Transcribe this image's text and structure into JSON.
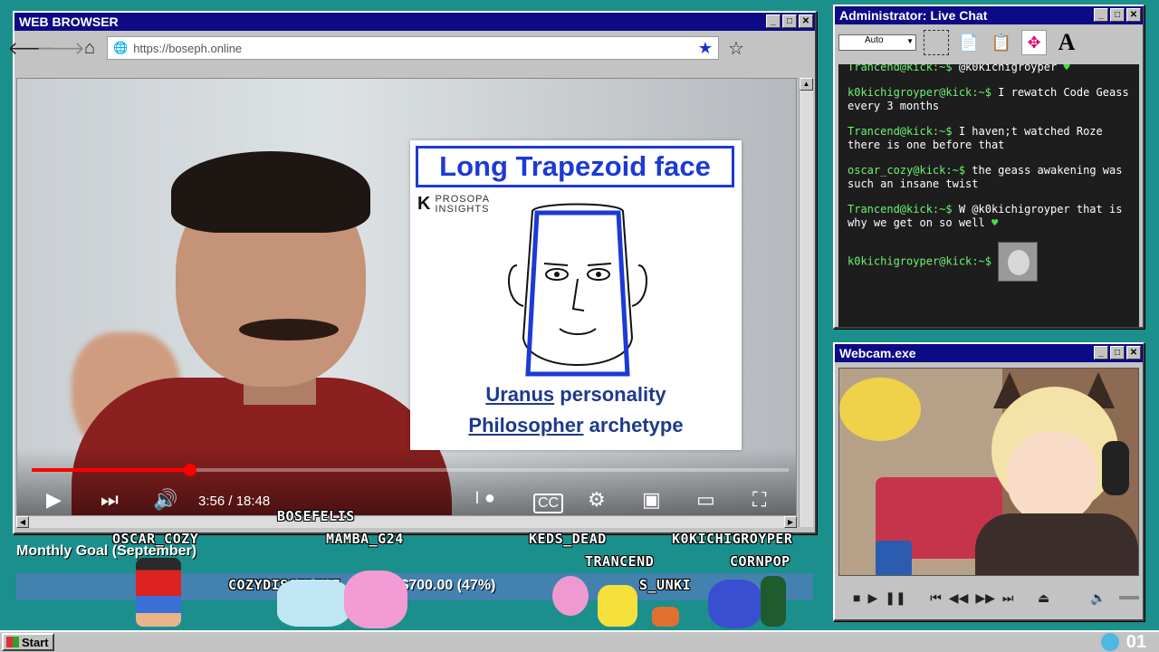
{
  "browser": {
    "title": "WEB BROWSER",
    "url": "https://boseph.online"
  },
  "slide": {
    "title": "Long Trapezoid face",
    "brand_line1": "PROSOPA",
    "brand_line2": "INSIGHTS",
    "line1_link": "Uranus",
    "line1_rest": " personality",
    "line2_link": "Philosopher",
    "line2_rest": " archetype"
  },
  "player": {
    "time": "3:56 / 18:48",
    "progress_fraction": 0.209
  },
  "chat": {
    "title": "Administrator: Live Chat",
    "font_select": "Auto",
    "messages": [
      {
        "user": "Trancend@kick:~$",
        "text": " @k0kichigroyper"
      },
      {
        "user": "k0kichigroyper@kick:~$",
        "text": " I rewatch Code Geass every 3 months"
      },
      {
        "user": "Trancend@kick:~$",
        "text": " I haven;t watched Roze there is one before that"
      },
      {
        "user": "oscar_cozy@kick:~$",
        "text": " the geass awakening was such an insane twist"
      },
      {
        "user": "Trancend@kick:~$",
        "text": " W @k0kichigroyper that is why we get on so well"
      },
      {
        "user": "k0kichigroyper@kick:~$",
        "text": ""
      }
    ]
  },
  "webcam": {
    "title": "Webcam.exe"
  },
  "overlay": {
    "names": [
      "BOSEFELIS",
      "OSCAR_COZY",
      "MAMBA_G24",
      "KEDS_DEAD",
      "K0KICHIGROYPER",
      "TRANCEND",
      "CORNPOP",
      "COZYDISSIDENT",
      "S_UNKI"
    ],
    "goal_label": "Monthly Goal (September)",
    "goal_text": "/$700.00 (47%)",
    "goal_fraction": 0.47
  },
  "taskbar": {
    "start": "Start",
    "clock": "01"
  },
  "colors": {
    "desktop": "#1b8f8c",
    "titlebar": "#0c0a84",
    "accent_blue": "#1c3ad4",
    "chat_user": "#6ff26f",
    "progress_red": "#ff0000"
  }
}
